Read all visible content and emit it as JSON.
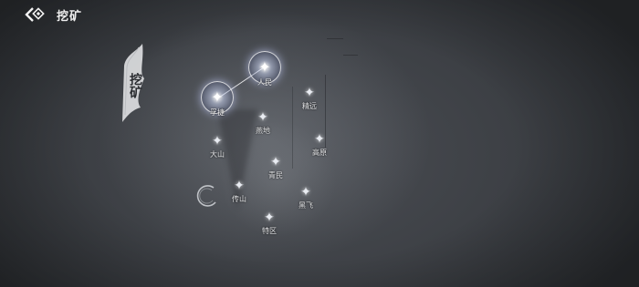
{
  "header": {
    "title": "挖矿"
  },
  "banner": {
    "text": "挖矿"
  },
  "nodes": [
    {
      "id": "renmin",
      "label": "人民",
      "active": true
    },
    {
      "id": "jiejing",
      "label": "孚捷",
      "active": true
    },
    {
      "id": "jingyuan",
      "label": "精远",
      "active": false
    },
    {
      "id": "diandi",
      "label": "燕地",
      "active": false
    },
    {
      "id": "gaoyuan",
      "label": "高原",
      "active": false
    },
    {
      "id": "dashan",
      "label": "大山",
      "active": false
    },
    {
      "id": "qingmin",
      "label": "青民",
      "active": false
    },
    {
      "id": "chuanjing",
      "label": "传山",
      "active": false
    },
    {
      "id": "heiyi",
      "label": "黑飞",
      "active": false
    },
    {
      "id": "tequ",
      "label": "特区",
      "active": false
    }
  ],
  "colors": {
    "background": "#3a3d42",
    "orb_glow": "#c8d2ff",
    "text": "#e3e4e6"
  },
  "icons": {
    "back": "back-arrow-diamond-icon",
    "star": "four-point-star-icon"
  }
}
